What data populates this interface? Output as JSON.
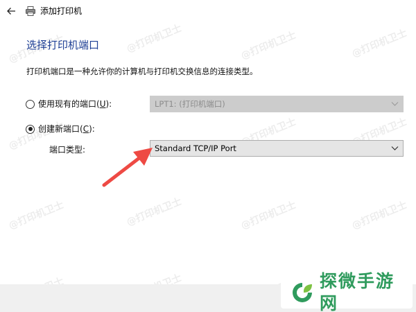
{
  "window": {
    "title": "添加打印机"
  },
  "main": {
    "heading": "选择打印机端口",
    "description": "打印机端口是一种允许你的计算机与打印机交换信息的连接类型。"
  },
  "existing_port": {
    "label_before": "使用现有的端口(",
    "access_key": "U",
    "label_after": "):",
    "selected": false,
    "dropdown_value": "LPT1: (打印机端口)",
    "enabled": false
  },
  "new_port": {
    "label_before": "创建新端口(",
    "access_key": "C",
    "label_after": "):",
    "selected": true,
    "type_label": "端口类型:",
    "dropdown_value": "Standard TCP/IP Port"
  },
  "watermark": {
    "text": "@打印机卫士"
  },
  "logo": {
    "text": "探微手游网"
  },
  "colors": {
    "heading": "#1e3f95",
    "arrow": "#ee4a44",
    "logo_green": "#2f9b5d"
  },
  "icons": {
    "back": "arrow-left-icon",
    "printer": "printer-icon",
    "dropdown": "chevron-down-icon",
    "annotation": "red-arrow-icon",
    "logo": "leaf-logo-icon"
  }
}
